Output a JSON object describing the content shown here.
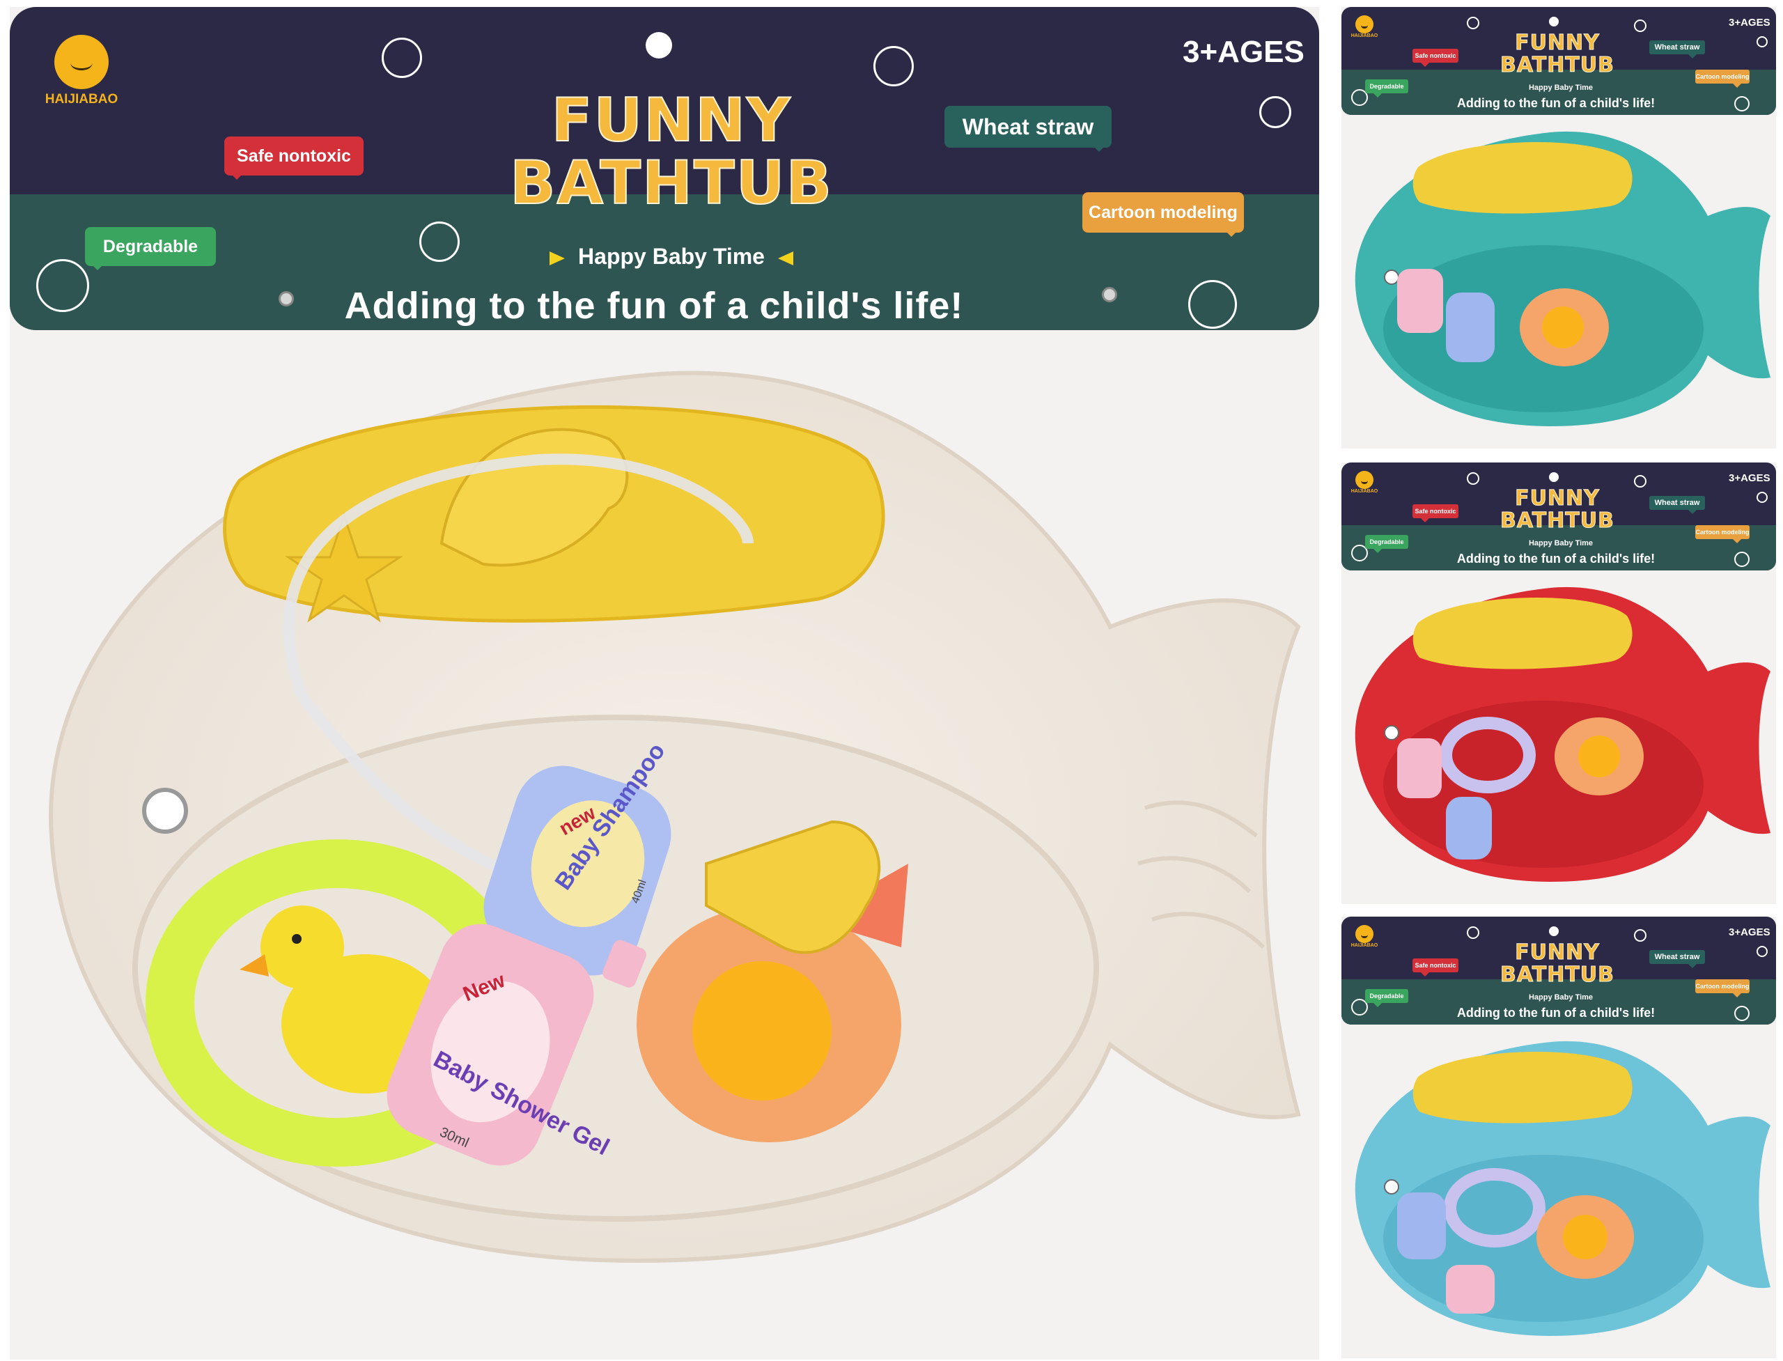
{
  "brand": "HAIJIABAO",
  "title_line1": "FUNNY",
  "title_line2": "BATHTUB",
  "age_label": "3+AGES",
  "tagline": "Happy Baby Time",
  "slogan": "Adding to the fun of a child's life!",
  "tags": {
    "safe": "Safe nontoxic",
    "degradable": "Degradable",
    "wheat": "Wheat straw",
    "cartoon": "Cartoon modeling"
  },
  "labels": {
    "shampoo_new": "new",
    "shampoo_name": "Baby Shampoo",
    "shampoo_volume": "40ml",
    "gel_new": "New",
    "gel_name": "Baby Shower Gel",
    "gel_volume": "30ml"
  },
  "variants": [
    {
      "tub_color": "#efe9e1"
    },
    {
      "tub_color": "#3fb3ae"
    },
    {
      "tub_color": "#dc2c33"
    },
    {
      "tub_color": "#6dc4d8"
    }
  ]
}
